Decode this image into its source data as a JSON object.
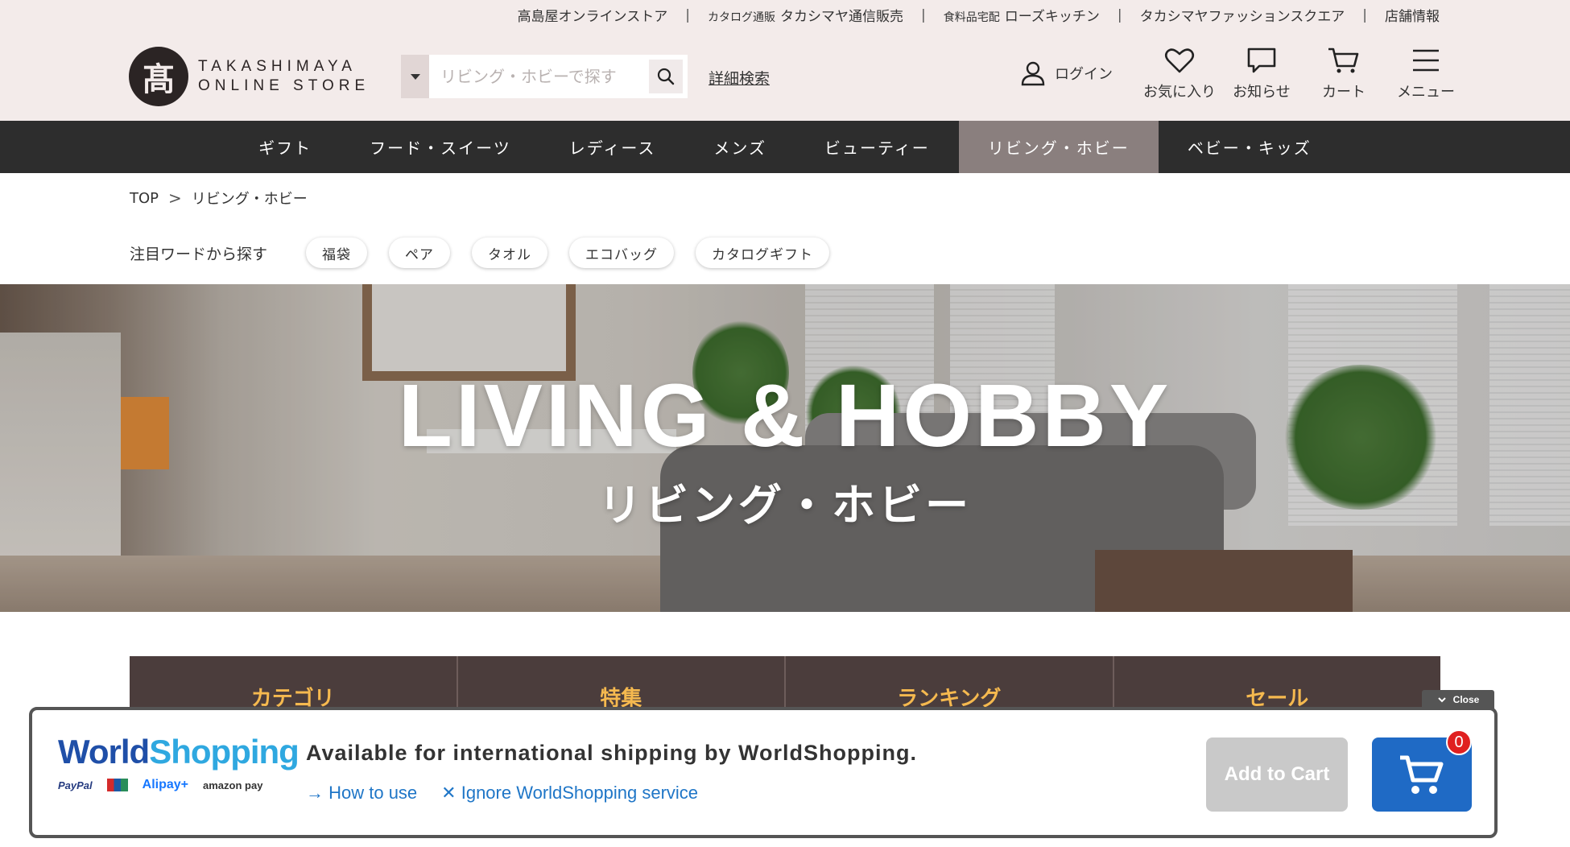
{
  "utility": {
    "links": [
      {
        "prefix": "",
        "label": "高島屋オンラインストア"
      },
      {
        "prefix": "カタログ通販",
        "label": "タカシマヤ通信販売"
      },
      {
        "prefix": "食料品宅配",
        "label": "ローズキッチン"
      },
      {
        "prefix": "",
        "label": "タカシマヤファッションスクエア"
      },
      {
        "prefix": "",
        "label": "店舗情報"
      }
    ],
    "separator": "|"
  },
  "logo": {
    "mark": "髙",
    "line1": "TAKASHIMAYA",
    "line2": "ONLINE STORE"
  },
  "search": {
    "placeholder": "リビング・ホビーで探す",
    "advanced": "詳細検索"
  },
  "header": {
    "login": "ログイン",
    "favorites": "お気に入り",
    "notices": "お知らせ",
    "cart": "カート",
    "menu": "メニュー"
  },
  "nav": {
    "items": [
      "ギフト",
      "フード・スイーツ",
      "レディース",
      "メンズ",
      "ビューティー",
      "リビング・ホビー",
      "ベビー・キッズ"
    ],
    "active_index": 5
  },
  "breadcrumb": {
    "top": "TOP",
    "chevron": ">",
    "current": "リビング・ホビー"
  },
  "keywords": {
    "label": "注目ワードから探す",
    "chips": [
      "福袋",
      "ペア",
      "タオル",
      "エコバッグ",
      "カタログギフト"
    ]
  },
  "hero": {
    "title": "LIVING & HOBBY",
    "subtitle": "リビング・ホビー"
  },
  "tabs": [
    "カテゴリ",
    "特集",
    "ランキング",
    "セール"
  ],
  "worldshopping": {
    "close": "Close",
    "logo_word1": "World",
    "logo_word2": "Shopping",
    "payments": [
      "PayPal",
      "UnionPay",
      "Alipay+",
      "amazon pay"
    ],
    "message": "Available for international shipping by WorldShopping.",
    "how_to": "→ How to use",
    "ignore": "✕ Ignore WorldShopping service",
    "add_to_cart": "Add to Cart",
    "cart_count": "0"
  },
  "colors": {
    "header_bg": "#f3ebea",
    "nav_bg": "#2d2d2d",
    "nav_active": "#8a7f7e",
    "tab_bg": "#4b3d3c",
    "tab_text": "#f5b94f",
    "ws_blue": "#1f6ac5"
  }
}
